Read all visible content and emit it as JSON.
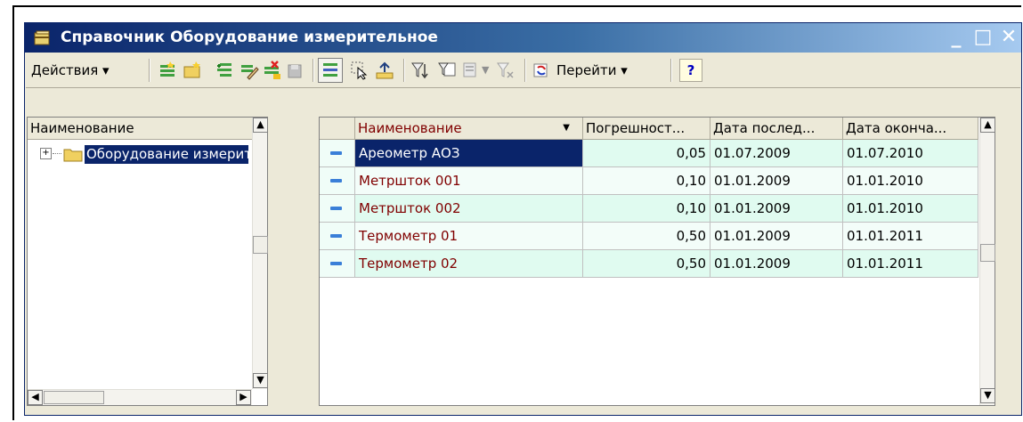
{
  "window": {
    "title": "Справочник Оборудование измерительное",
    "title_icon": "catalog-icon",
    "controls": {
      "minimize": "_",
      "maximize": "□",
      "close": "✕"
    }
  },
  "toolbar": {
    "actions_label": "Действия ▾",
    "goto_label": "Перейти ▾",
    "help_label": "?"
  },
  "tree": {
    "header": "Наименование",
    "items": [
      {
        "expander": "⊞",
        "label": "Оборудование измерительное",
        "icon": "folder-icon"
      }
    ]
  },
  "table": {
    "columns": [
      "Наименование",
      "Погрешност...",
      "Дата послед...",
      "Дата оконча..."
    ],
    "sort_indicator": "▼",
    "rows": [
      {
        "name": "Ареометр АОЗ",
        "error": "0,05",
        "last_date": "01.07.2009",
        "end_date": "01.07.2010",
        "selected": true
      },
      {
        "name": "Метршток 001",
        "error": "0,10",
        "last_date": "01.01.2009",
        "end_date": "01.01.2010",
        "selected": false
      },
      {
        "name": "Метршток 002",
        "error": "0,10",
        "last_date": "01.01.2009",
        "end_date": "01.01.2010",
        "selected": false
      },
      {
        "name": "Термометр 01",
        "error": "0,50",
        "last_date": "01.01.2009",
        "end_date": "01.01.2011",
        "selected": false
      },
      {
        "name": "Термометр 02",
        "error": "0,50",
        "last_date": "01.01.2009",
        "end_date": "01.01.2011",
        "selected": false
      }
    ]
  },
  "colors": {
    "titlebar_start": "#0a246a",
    "titlebar_end": "#a6caf0",
    "selection": "#0a246a",
    "row_text": "#800000",
    "row_bg": "#e0fbf0"
  }
}
